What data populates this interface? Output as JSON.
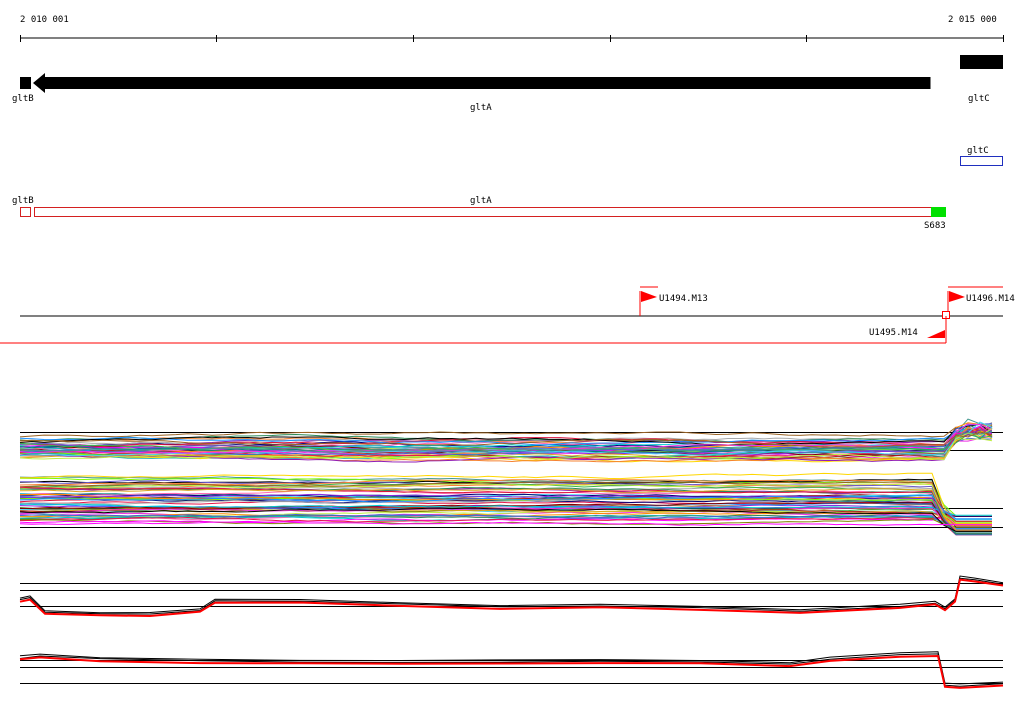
{
  "ruler": {
    "start_label": "2 010 001",
    "end_label": "2 015 000",
    "ticks": [
      2010001,
      2011000,
      2012000,
      2013000,
      2014000,
      2015000
    ]
  },
  "genes": [
    {
      "name": "gltB",
      "strand": "-"
    },
    {
      "name": "gltA",
      "strand": "-"
    },
    {
      "name": "gltC",
      "strand": "+"
    }
  ],
  "annotation_track": {
    "boxes": [
      {
        "label": "gltC",
        "color": "#1f2fbf"
      },
      {
        "label": "gltB",
        "color": "#d42020"
      },
      {
        "label": "gltA",
        "color": "#d42020"
      },
      {
        "label": "S683",
        "color": "#00e000"
      }
    ]
  },
  "transcription_units": {
    "labels": [
      "U1494.M13",
      "U1496.M14",
      "U1495.M14"
    ],
    "color": "#ff0000"
  },
  "expression_panels": [
    {
      "name": "forward-strand-conditions",
      "style": "multicolor"
    },
    {
      "name": "reverse-strand-conditions",
      "style": "multicolor"
    },
    {
      "name": "forward-strand-summary",
      "series_colors": [
        "#000000",
        "#000000",
        "#ff0000"
      ]
    },
    {
      "name": "reverse-strand-summary",
      "series_colors": [
        "#000000",
        "#000000",
        "#ff0000"
      ]
    }
  ]
}
